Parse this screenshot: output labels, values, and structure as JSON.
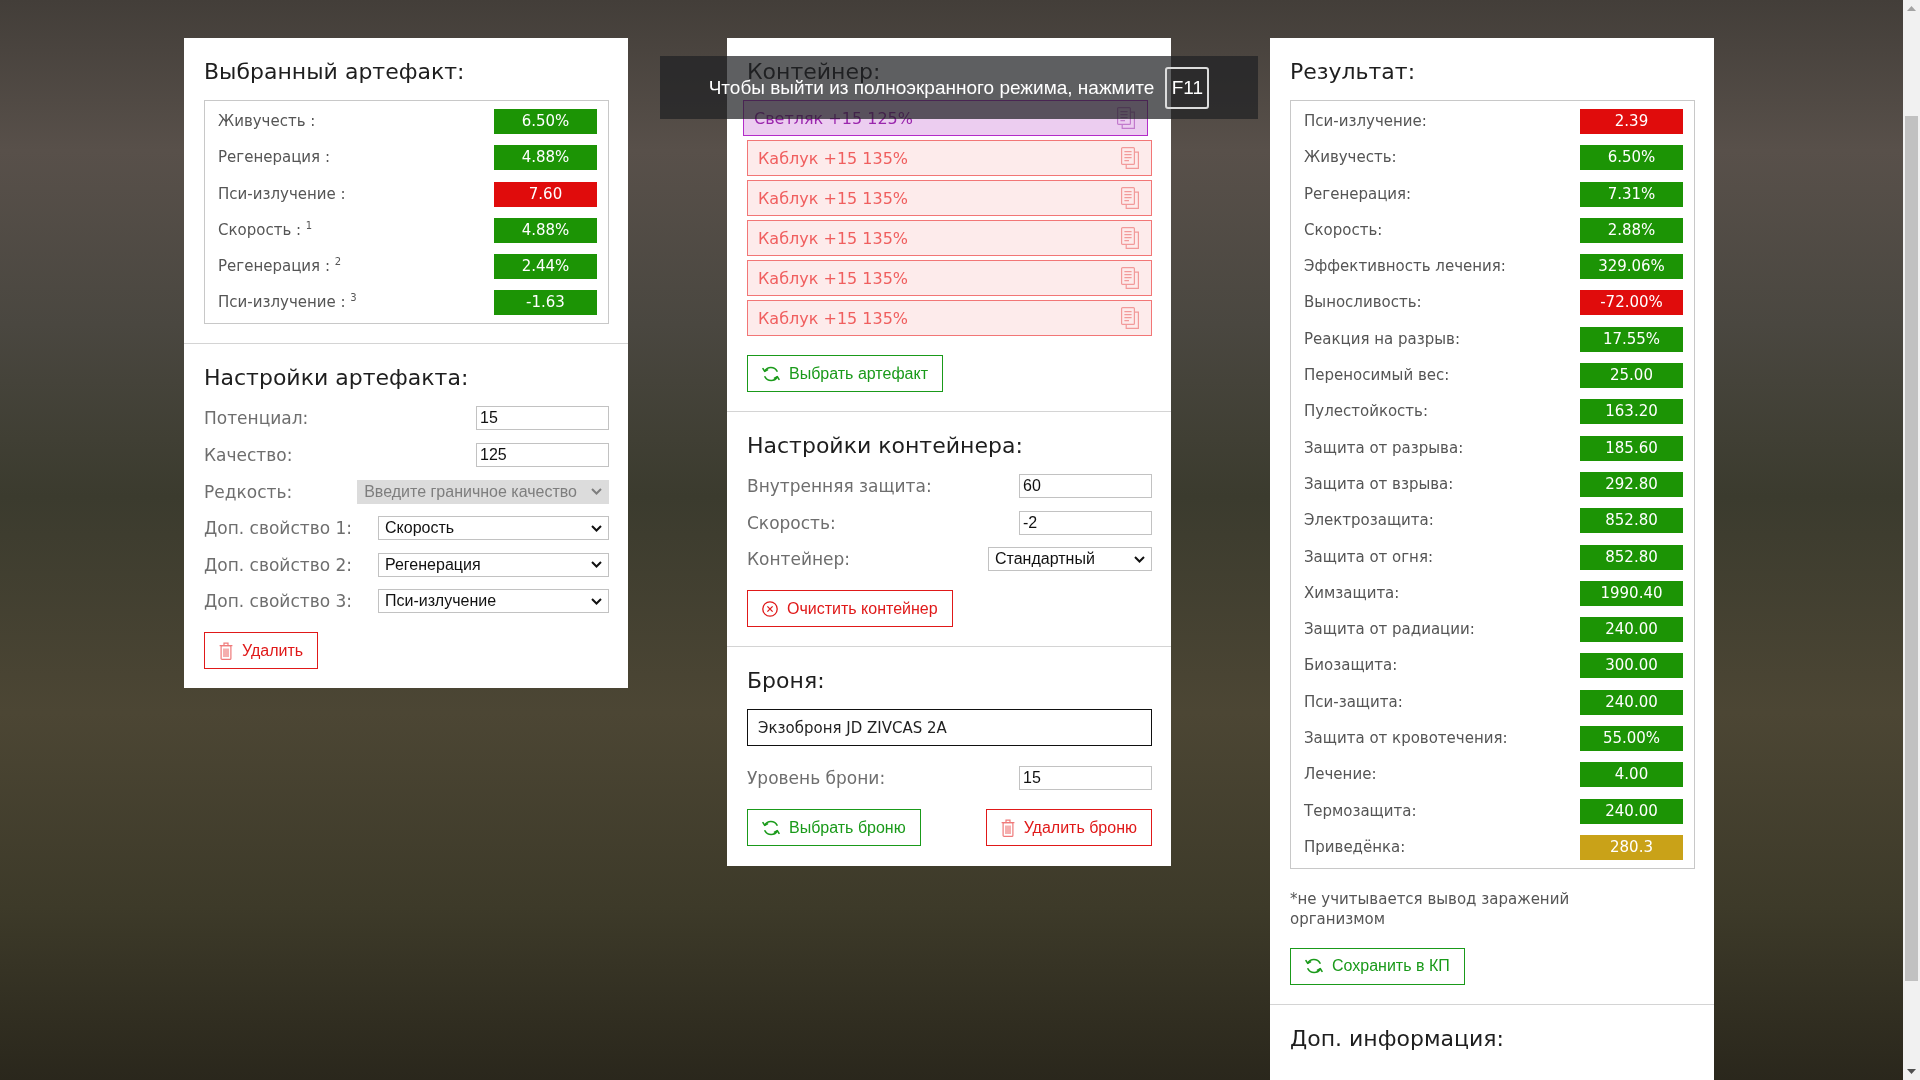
{
  "fullscreen_notice": {
    "text": "Чтобы выйти из полноэкранного режима, нажмите",
    "key": "F11"
  },
  "artifact_panel": {
    "title": "Выбранный артефакт:",
    "stats": [
      {
        "label": "Живучесть :",
        "value": "6.50%",
        "color": "#1c9405"
      },
      {
        "label": "Регенерация :",
        "value": "4.88%",
        "color": "#1c9405"
      },
      {
        "label": "Пси-излучение :",
        "value": "7.60",
        "color": "#e00c0c"
      },
      {
        "label": "Скорость : $^{1}$",
        "value": "4.88%",
        "color": "#1c9405"
      },
      {
        "label": "Регенерация : $^{2}$",
        "value": "2.44%",
        "color": "#1c9405"
      },
      {
        "label": "Пси-излучение : $^{3}$",
        "value": "-1.63",
        "color": "#1c9405"
      }
    ],
    "settings_title": "Настройки артефакта:",
    "settings": [
      {
        "kind": "input",
        "label": "Потенциал:",
        "value": "15",
        "disabled": false
      },
      {
        "kind": "input",
        "label": "Качество:",
        "value": "125",
        "disabled": false
      },
      {
        "kind": "select",
        "label": "Редкость:",
        "value": "Введите граничное качество",
        "disabled": true
      },
      {
        "kind": "select",
        "label": "Доп. свойство 1:",
        "value": "Скорость",
        "disabled": false
      },
      {
        "kind": "select",
        "label": "Доп. свойство 2:",
        "value": "Регенерация",
        "disabled": false
      },
      {
        "kind": "select",
        "label": "Доп. свойство 3:",
        "value": "Пси-излучение",
        "disabled": false
      }
    ],
    "delete_button": "Удалить"
  },
  "container_panel": {
    "title": "Контейнер:",
    "items": [
      {
        "name": "Светляк +15 125%",
        "selected": true
      },
      {
        "name": "Каблук +15 135%",
        "selected": false
      },
      {
        "name": "Каблук +15 135%",
        "selected": false
      },
      {
        "name": "Каблук +15 135%",
        "selected": false
      },
      {
        "name": "Каблук +15 135%",
        "selected": false
      },
      {
        "name": "Каблук +15 135%",
        "selected": false
      }
    ],
    "select_button": "Выбрать артефакт",
    "settings_title": "Настройки контейнера:",
    "settings": [
      {
        "kind": "input",
        "label": "Внутренняя защита:",
        "value": "60",
        "disabled": false
      },
      {
        "kind": "input",
        "label": "Скорость:",
        "value": "-2",
        "disabled": false
      },
      {
        "kind": "select",
        "label": "Контейнер:",
        "value": "Стандартный",
        "disabled": false
      }
    ],
    "clear_button": "Очистить контейнер"
  },
  "armor": {
    "title": "Броня:",
    "name": "Экзоброня JD ZIVCAS 2A",
    "settings": [
      {
        "kind": "input",
        "label": "Уровень брони:",
        "value": "15",
        "disabled": false
      }
    ],
    "select_button": "Выбрать броню",
    "delete_button": "Удалить броню"
  },
  "result_panel": {
    "title": "Результат:",
    "stats": [
      {
        "label": "Пси-излучение:",
        "value": "2.39",
        "color": "#e00c0c"
      },
      {
        "label": "Живучесть:",
        "value": "6.50%",
        "color": "#1c9405"
      },
      {
        "label": "Регенерация:",
        "value": "7.31%",
        "color": "#1c9405"
      },
      {
        "label": "Скорость:",
        "value": "2.88%",
        "color": "#1c9405"
      },
      {
        "label": "Эффективность лечения:",
        "value": "329.06%",
        "color": "#1c9405"
      },
      {
        "label": "Выносливость:",
        "value": "-72.00%",
        "color": "#e00c0c"
      },
      {
        "label": "Реакция на разрыв:",
        "value": "17.55%",
        "color": "#1c9405"
      },
      {
        "label": "Переносимый вес:",
        "value": "25.00",
        "color": "#1c9405"
      },
      {
        "label": "Пулестойкость:",
        "value": "163.20",
        "color": "#1c9405"
      },
      {
        "label": "Защита от разрыва:",
        "value": "185.60",
        "color": "#1c9405"
      },
      {
        "label": "Защита от взрыва:",
        "value": "292.80",
        "color": "#1c9405"
      },
      {
        "label": "Электрозащита:",
        "value": "852.80",
        "color": "#1c9405"
      },
      {
        "label": "Защита от огня:",
        "value": "852.80",
        "color": "#1c9405"
      },
      {
        "label": "Химзащита:",
        "value": "1990.40",
        "color": "#1c9405"
      },
      {
        "label": "Защита от радиации:",
        "value": "240.00",
        "color": "#1c9405"
      },
      {
        "label": "Биозащита:",
        "value": "300.00",
        "color": "#1c9405"
      },
      {
        "label": "Пси-защита:",
        "value": "240.00",
        "color": "#1c9405"
      },
      {
        "label": "Защита от кровотечения:",
        "value": "55.00%",
        "color": "#1c9405"
      },
      {
        "label": "Лечение:",
        "value": "4.00",
        "color": "#1c9405"
      },
      {
        "label": "Термозащита:",
        "value": "240.00",
        "color": "#1c9405"
      },
      {
        "label": "Приведёнка:",
        "value": "280.3",
        "color": "#c9a218"
      }
    ],
    "note": "*не учитывается вывод заражений организмом",
    "save_button": "Сохранить в КП",
    "extra_title": "Доп. информация:"
  }
}
